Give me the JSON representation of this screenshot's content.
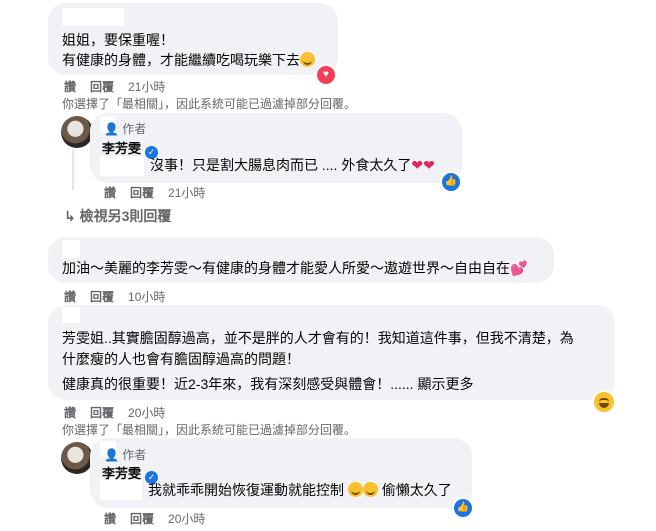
{
  "actions": {
    "like": "讚",
    "reply": "回覆"
  },
  "notice": "你選擇了「最相關」，因此系統可能已過濾掉部分回覆。",
  "comments": [
    {
      "line1": "姐姐，要保重喔！",
      "line2": "有健康的身體，才能繼續吃喝玩樂下去",
      "time": "21小時"
    },
    {
      "author_tag": "作者",
      "author_name": "李芳雯",
      "text": "沒事！只是割大腸息肉而已 .... 外食太久了",
      "time": "21小時"
    },
    {
      "view_more": "檢視另3則回覆"
    },
    {
      "text": "加油～美麗的李芳雯～有健康的身體才能愛人所愛～遨遊世界～自由自在",
      "time": "10小時"
    },
    {
      "line1": "芳雯姐..其實膽固醇過高，並不是胖的人才會有的！我知道這件事，但我不清楚，為",
      "line2": "什麼瘦的人也會有膽固醇過高的問題！",
      "line3": "健康真的很重要！近2-3年來，我有深刻感受與體會！...... 顯示更多",
      "time": "20小時"
    },
    {
      "author_tag": "作者",
      "author_name": "李芳雯",
      "text_a": "我就乖乖開始恢復運動就能控制",
      "text_b": "偷懶太久了",
      "time": "20小時"
    }
  ],
  "icons": {
    "love": "heart-reaction",
    "like": "thumbs-up-reaction",
    "haha": "haha-reaction",
    "verified": "verified-badge"
  },
  "colors": {
    "bubble": "#f0f2f5",
    "secondary_text": "#65676b",
    "brand_blue": "#1b74e4",
    "love_red": "#f33e58"
  }
}
